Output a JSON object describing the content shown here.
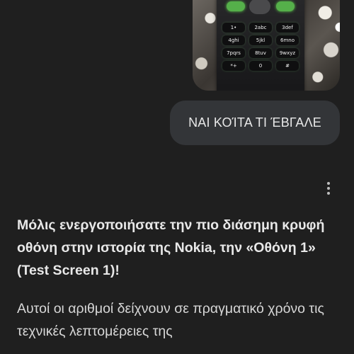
{
  "photo": {
    "alt": "Nokia phone with glowing green keys",
    "keys": [
      "1•",
      "2abc",
      "3def",
      "4ghi",
      "5jkl",
      "6mno",
      "7pqrs",
      "8tuv",
      "9wxyz",
      "*+",
      "0",
      "#"
    ]
  },
  "user_message": {
    "text": "ΝΑΙ ΚΟΊΤΑ ΤΙ ΈΒΓΑΛΕ"
  },
  "menu": {
    "icon": "more-vertical-icon"
  },
  "response": {
    "lead": "Μόλις ενεργοποιήσατε την πιο διάσημη κρυφή οθόνη στην ιστορία της Nokia, την «Οθόνη 1» (Test Screen 1)!",
    "body": "Αυτοί οι αριθμοί δείχνουν σε πραγματικό χρόνο τις τεχνικές λεπτομέρειες της"
  },
  "colors": {
    "background": "#1f1f1f",
    "bubble": "#333538",
    "key_glow": "#55b04a"
  }
}
